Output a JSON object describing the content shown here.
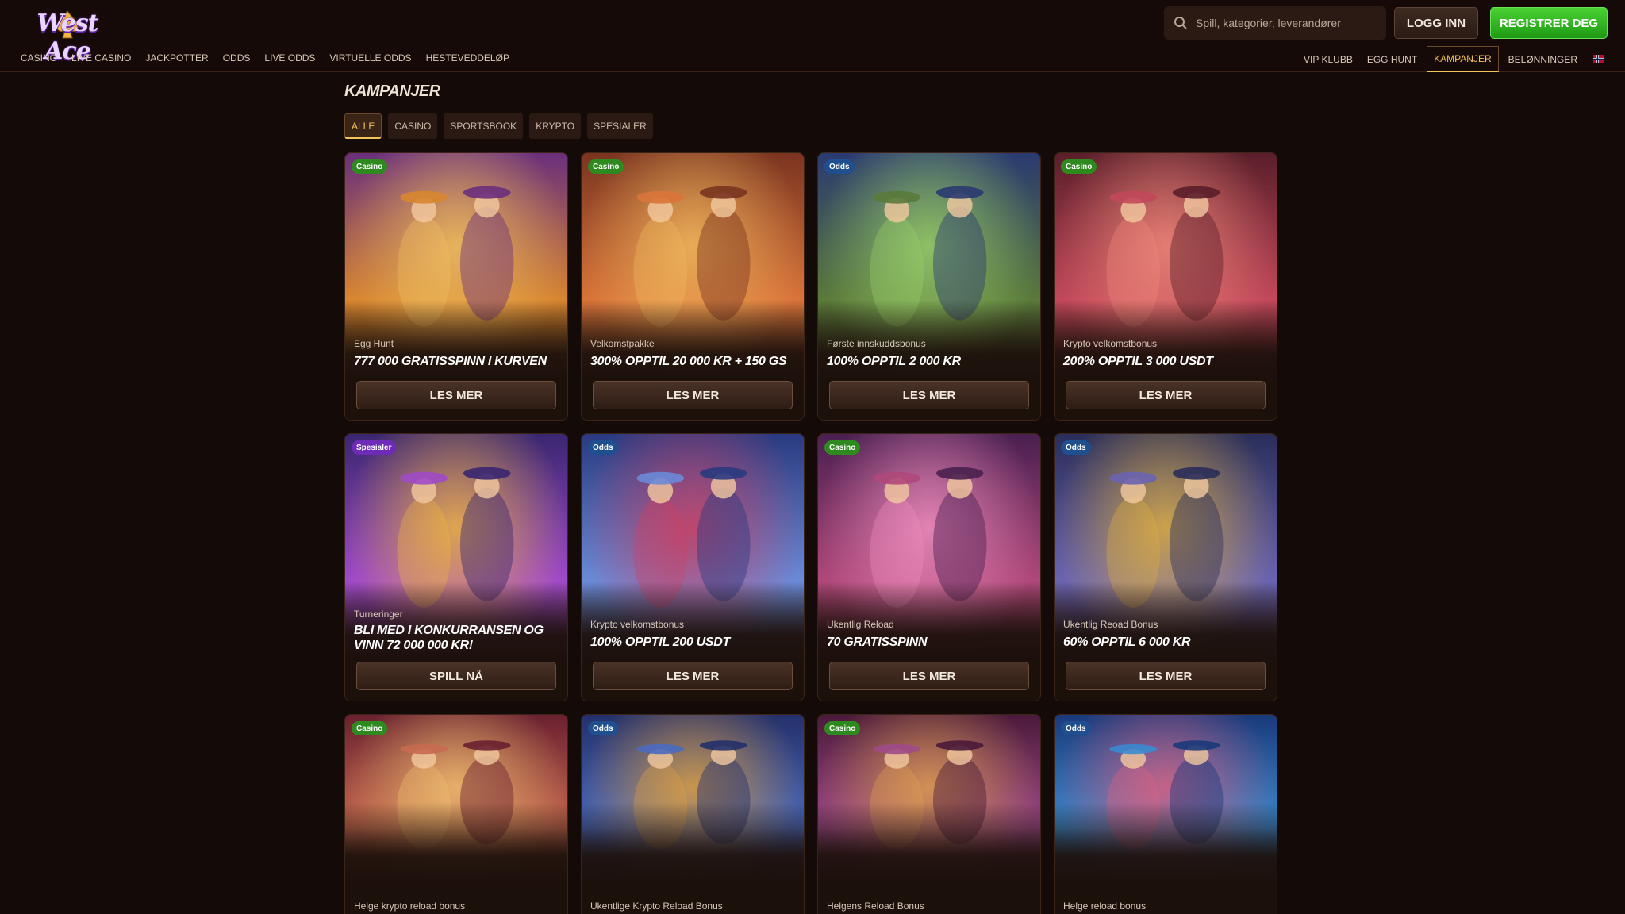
{
  "brand": {
    "logo_text": "West Ace"
  },
  "search": {
    "placeholder": "Spill, kategorier, leverandører"
  },
  "header": {
    "login_label": "LOGG INN",
    "register_label": "REGISTRER DEG"
  },
  "nav_left": [
    "CASINO",
    "LIVE CASINO",
    "JACKPOTTER",
    "ODDS",
    "LIVE ODDS",
    "VIRTUELLE ODDS",
    "HESTEVEDDELØP"
  ],
  "nav_right": [
    "VIP KLUBB",
    "EGG HUNT",
    "KAMPANJER",
    "BELØNNINGER"
  ],
  "nav_right_active": "KAMPANJER",
  "page": {
    "title": "KAMPANJER"
  },
  "filters": [
    "ALLE",
    "CASINO",
    "SPORTSBOOK",
    "KRYPTO",
    "SPESIALER"
  ],
  "filter_active": "ALLE",
  "cards": [
    {
      "badge": "Casino",
      "type": "casino",
      "sub": "Egg Hunt",
      "title": "777 000 GRATISSPINN I KURVEN",
      "button": "LES MER",
      "palette": [
        "#6a2f7c",
        "#d8862f",
        "#f0c060"
      ]
    },
    {
      "badge": "Casino",
      "type": "casino",
      "sub": "Velkomstpakke",
      "title": "300% OPPTIL 20 000 KR + 150 GS",
      "button": "LES MER",
      "palette": [
        "#7a3420",
        "#d9743a",
        "#f2b95e"
      ]
    },
    {
      "badge": "Odds",
      "type": "odds",
      "sub": "Første innskuddsbonus",
      "title": "100% OPPTIL 2 000 KR",
      "button": "LES MER",
      "palette": [
        "#2a3a70",
        "#5a7a3a",
        "#9bd06a"
      ]
    },
    {
      "badge": "Casino",
      "type": "casino",
      "sub": "Krypto velkomstbonus",
      "title": "200% OPPTIL 3 000 USDT",
      "button": "LES MER",
      "palette": [
        "#5a1e2a",
        "#c2485a",
        "#f08a7a"
      ]
    },
    {
      "badge": "Spesialer",
      "type": "spesialer",
      "sub": "Turneringer",
      "title": "BLI MED I KONKURRANSEN OG VINN 72 000 000 KR!",
      "button": "SPILL NÅ",
      "palette": [
        "#3a2670",
        "#a04ac8",
        "#f0b840"
      ]
    },
    {
      "badge": "Odds",
      "type": "odds",
      "sub": "Krypto velkomstbonus",
      "title": "100% OPPTIL 200 USDT",
      "button": "LES MER",
      "palette": [
        "#2a3a80",
        "#6a8ad8",
        "#d04060"
      ]
    },
    {
      "badge": "Casino",
      "type": "casino",
      "sub": "Ukentlig Reload",
      "title": "70 GRATISSPINN",
      "button": "LES MER",
      "palette": [
        "#4a2050",
        "#b0487a",
        "#f090c0"
      ]
    },
    {
      "badge": "Odds",
      "type": "odds",
      "sub": "Ukentlig Reoad Bonus",
      "title": "60% OPPTIL 6 000 KR",
      "button": "LES MER",
      "palette": [
        "#2a2e5a",
        "#6a64b0",
        "#e0b040"
      ]
    },
    {
      "badge": "Casino",
      "type": "casino",
      "sub": "Helge krypto reload bonus",
      "title": "",
      "button": "",
      "palette": [
        "#6a2030",
        "#c86a50",
        "#f0c070"
      ]
    },
    {
      "badge": "Odds",
      "type": "odds",
      "sub": "Ukentlige Krypto Reload Bonus",
      "title": "",
      "button": "",
      "palette": [
        "#24306a",
        "#4a6ac0",
        "#e0a040"
      ]
    },
    {
      "badge": "Casino",
      "type": "casino",
      "sub": "Helgens Reload Bonus",
      "title": "",
      "button": "",
      "palette": [
        "#4a1a3a",
        "#a04a8a",
        "#e0a050"
      ]
    },
    {
      "badge": "Odds",
      "type": "odds",
      "sub": "Helge reload bonus",
      "title": "",
      "button": "",
      "palette": [
        "#1a3a7a",
        "#3a8ad0",
        "#e06080"
      ]
    }
  ]
}
